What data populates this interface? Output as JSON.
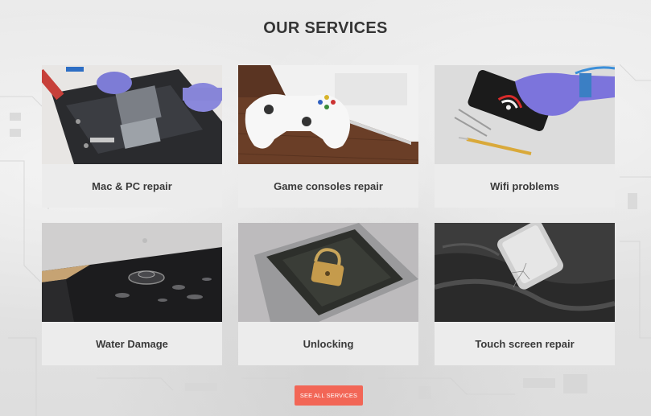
{
  "section": {
    "title": "OUR SERVICES"
  },
  "services": [
    {
      "label": "Mac & PC repair",
      "image": "laptop-repair-photo"
    },
    {
      "label": "Game consoles repair",
      "image": "game-console-photo"
    },
    {
      "label": "Wifi problems",
      "image": "phone-wifi-photo"
    },
    {
      "label": "Water Damage",
      "image": "water-damage-photo"
    },
    {
      "label": "Unlocking",
      "image": "phone-padlock-photo"
    },
    {
      "label": "Touch screen repair",
      "image": "cracked-screen-photo"
    }
  ],
  "cta": {
    "label": "SEE ALL SERVICES"
  },
  "colors": {
    "accent": "#f26656",
    "card_background": "#ececec",
    "heading": "#353535"
  }
}
